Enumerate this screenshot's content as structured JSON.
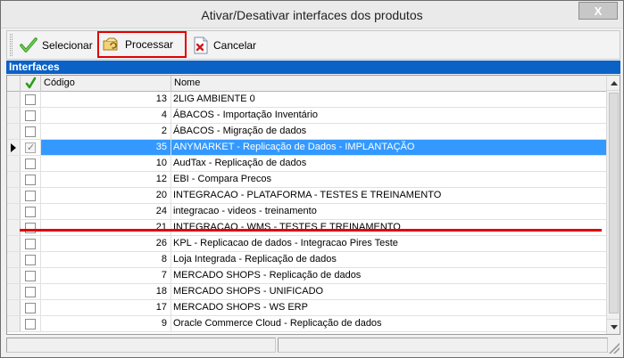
{
  "window": {
    "title": "Ativar/Desativar interfaces dos produtos",
    "close_label": "X"
  },
  "toolbar": {
    "select_label": "Selecionar",
    "process_label": "Processar",
    "cancel_label": "Cancelar",
    "icons": {
      "select": "checkmark-icon",
      "process": "process-icon",
      "cancel": "cancel-document-icon"
    },
    "highlighted_button": "Processar"
  },
  "panel": {
    "title": "Interfaces"
  },
  "grid": {
    "columns": {
      "check": "✓",
      "code": "Código",
      "name": "Nome"
    },
    "selected_row_index": 3,
    "rows": [
      {
        "code": "13",
        "name": "2LIG AMBIENTE 0",
        "checked": false
      },
      {
        "code": "4",
        "name": "ÁBACOS - Importação Inventário",
        "checked": false
      },
      {
        "code": "2",
        "name": "ÁBACOS - Migração de dados",
        "checked": false
      },
      {
        "code": "35",
        "name": "ANYMARKET - Replicação de Dados - IMPLANTAÇÃO",
        "checked": true
      },
      {
        "code": "10",
        "name": "AudTax - Replicação de dados",
        "checked": false
      },
      {
        "code": "12",
        "name": "EBI - Compara Precos",
        "checked": false
      },
      {
        "code": "20",
        "name": "INTEGRACAO - PLATAFORMA - TESTES E TREINAMENTO",
        "checked": false
      },
      {
        "code": "24",
        "name": "integracao - videos - treinamento",
        "checked": false
      },
      {
        "code": "21",
        "name": "INTEGRACAO - WMS - TESTES E TREINAMENTO",
        "checked": false
      },
      {
        "code": "26",
        "name": "KPL - Replicacao de dados - Integracao Pires Teste",
        "checked": false
      },
      {
        "code": "8",
        "name": "Loja Integrada - Replicação de dados",
        "checked": false
      },
      {
        "code": "7",
        "name": "MERCADO SHOPS - Replicação de dados",
        "checked": false
      },
      {
        "code": "18",
        "name": "MERCADO SHOPS - UNIFICADO",
        "checked": false
      },
      {
        "code": "17",
        "name": "MERCADO SHOPS - WS ERP",
        "checked": false
      },
      {
        "code": "9",
        "name": "Oracle Commerce Cloud - Replicação de dados",
        "checked": false
      }
    ]
  },
  "colors": {
    "panel_header": "#0a62c6",
    "selection": "#3399ff",
    "annotation_red": "#e00000"
  }
}
